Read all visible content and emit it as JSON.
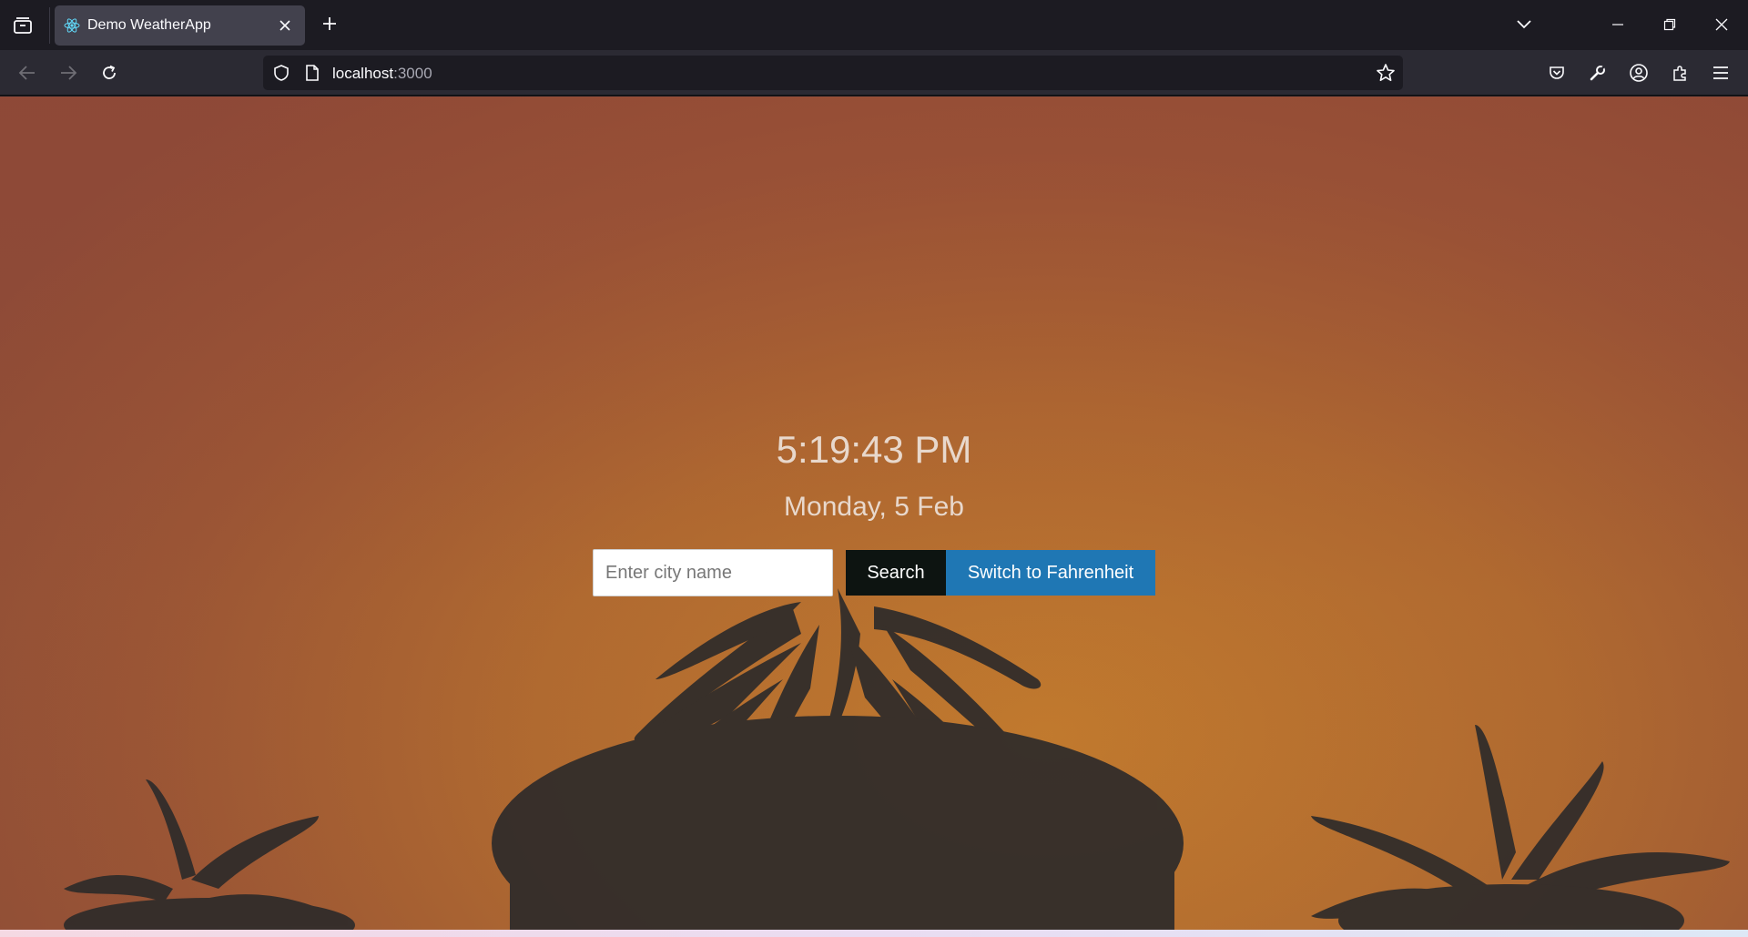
{
  "browser": {
    "tab": {
      "title": "Demo WeatherApp",
      "favicon": "react-icon"
    },
    "url": {
      "host": "localhost",
      "port": ":3000"
    },
    "icons": [
      "tab-list-icon",
      "close-icon",
      "plus-icon",
      "chevron-down-icon",
      "minimize-icon",
      "restore-icon",
      "close-window-icon",
      "back-arrow-icon",
      "forward-arrow-icon",
      "reload-icon",
      "shield-icon",
      "page-icon",
      "star-icon",
      "pocket-icon",
      "wrench-icon",
      "account-icon",
      "extensions-icon",
      "menu-icon"
    ]
  },
  "app": {
    "time": "5:19:43 PM",
    "date": "Monday, 5 Feb",
    "search": {
      "placeholder": "Enter city name",
      "value": ""
    },
    "search_button": "Search",
    "unit_button": "Switch to Fahrenheit"
  },
  "colors": {
    "background_top": "#8f4d38",
    "background_mid": "#b36c32",
    "unit_button": "#1f77b4",
    "search_button": "#0d1411"
  }
}
